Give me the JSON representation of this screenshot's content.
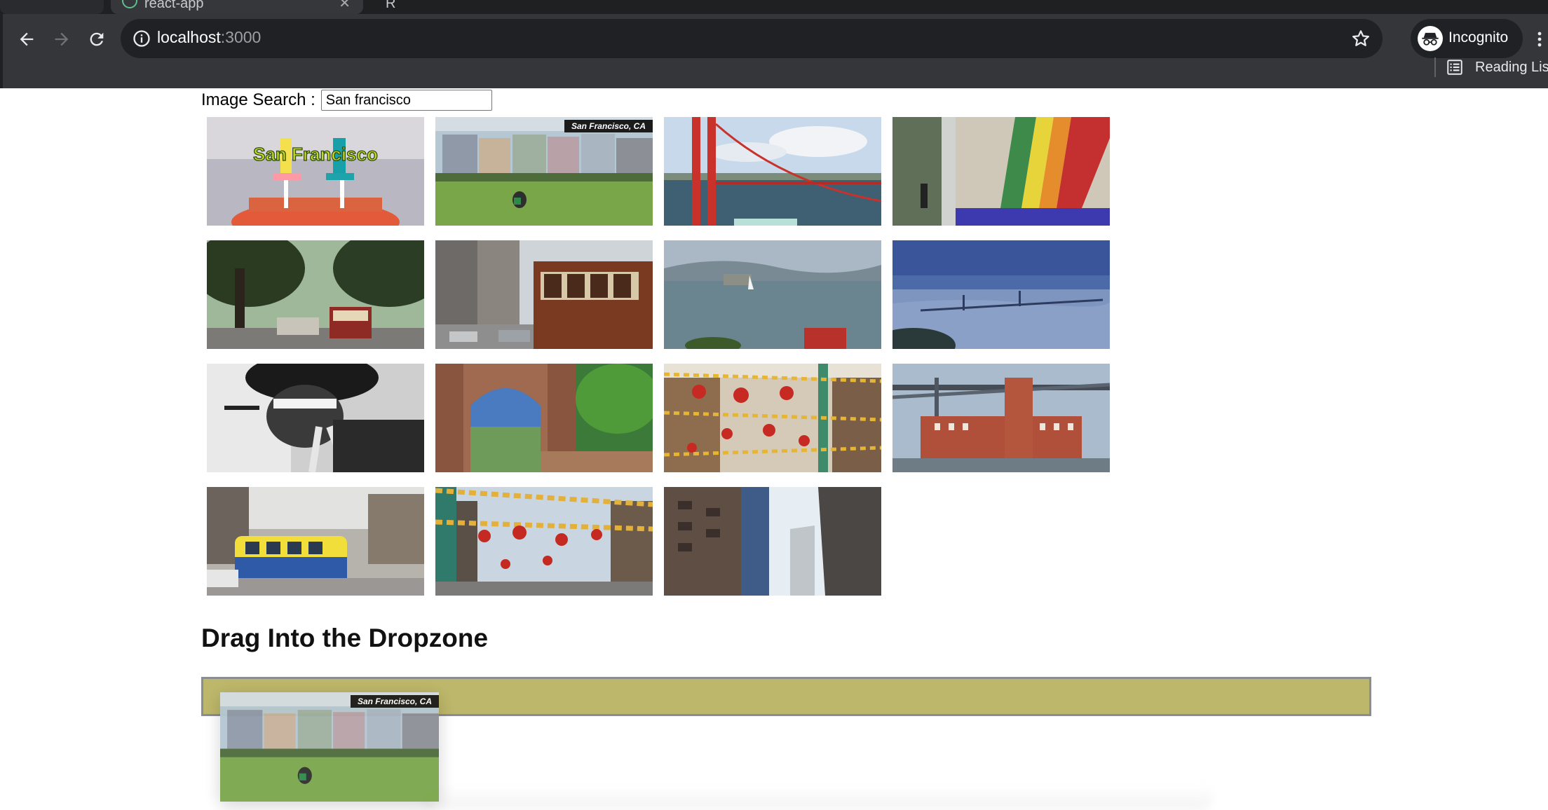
{
  "browser": {
    "tab_label": "react-app",
    "tab2_label": "R",
    "url_host": "localhost",
    "url_port": ":3000",
    "profile_label": "Incognito",
    "reading_list_label": "Reading List",
    "icons": {
      "back": "arrow-left-icon",
      "forward": "arrow-right-icon",
      "reload": "reload-icon",
      "info": "info-icon",
      "star": "star-icon",
      "incognito": "incognito-icon",
      "menu": "kebab-menu-icon",
      "reading_list": "reading-list-icon"
    }
  },
  "search": {
    "label": "Image Search :",
    "value": "San francisco"
  },
  "images": [
    {
      "caption": "San Francisco",
      "scene": "title-card-exercise"
    },
    {
      "caption": "San Francisco, CA",
      "scene": "painted-ladies"
    },
    {
      "caption": "",
      "scene": "golden-gate-tower"
    },
    {
      "caption": "",
      "scene": "rainbow-mural"
    },
    {
      "caption": "",
      "scene": "street-trees-cablecar"
    },
    {
      "caption": "",
      "scene": "cable-car-street"
    },
    {
      "caption": "",
      "scene": "alcatraz-bay"
    },
    {
      "caption": "",
      "scene": "bay-bridge-distant"
    },
    {
      "caption": "",
      "scene": "rapper-portrait-bw"
    },
    {
      "caption": "",
      "scene": "palace-fine-arts"
    },
    {
      "caption": "",
      "scene": "chinatown-lanterns"
    },
    {
      "caption": "",
      "scene": "ferry-building-bridge"
    },
    {
      "caption": "",
      "scene": "yellow-streetcar"
    },
    {
      "caption": "",
      "scene": "chinatown-flags"
    },
    {
      "caption": "",
      "scene": "skyscrapers"
    }
  ],
  "dropzone": {
    "heading": "Drag Into the Dropzone",
    "color": "#bdb76b",
    "dragged_caption": "San Francisco, CA"
  }
}
